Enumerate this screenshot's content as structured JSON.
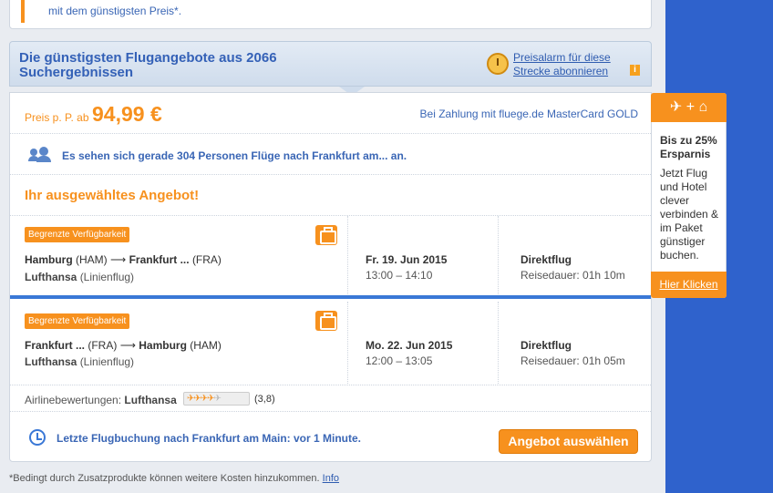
{
  "notice": {
    "text": "mit dem günstigsten Preis*."
  },
  "header": {
    "title": "Die günstigsten Flugangebote aus 2066 Suchergebnissen",
    "alarm_line1": "Preisalarm für diese",
    "alarm_line2": "Strecke abonnieren",
    "info_glyph": "i"
  },
  "price": {
    "label": "Preis p. P. ab",
    "value": "94,99 €",
    "payment_note": "Bei Zahlung mit fluege.de MasterCard GOLD"
  },
  "people": {
    "text": "Es sehen sich gerade 304 Personen Flüge nach Frankfurt am... an."
  },
  "selected": {
    "title": "Ihr ausgewähltes Angebot!"
  },
  "flights": [
    {
      "badge": "Begrenzte Verfügbarkeit",
      "from_city": "Hamburg",
      "from_code": "(HAM)",
      "arrow": "⟶",
      "to_city": "Frankfurt ...",
      "to_code": "(FRA)",
      "airline": "Lufthansa",
      "airline_type": "(Linienflug)",
      "date": "Fr. 19. Jun 2015",
      "time": "13:00 – 14:10",
      "direct": "Direktflug",
      "duration": "Reisedauer: 01h 10m"
    },
    {
      "badge": "Begrenzte Verfügbarkeit",
      "from_city": "Frankfurt ...",
      "from_code": "(FRA)",
      "arrow": "⟶",
      "to_city": "Hamburg",
      "to_code": "(HAM)",
      "airline": "Lufthansa",
      "airline_type": "(Linienflug)",
      "date": "Mo. 22. Jun 2015",
      "time": "12:00 – 13:05",
      "direct": "Direktflug",
      "duration": "Reisedauer: 01h 05m"
    }
  ],
  "rating": {
    "label": "Airlinebewertungen:",
    "airline": "Lufthansa",
    "value": "(3,8)",
    "stars": 3.8,
    "stars_max": 5
  },
  "last_booking": {
    "text": "Letzte Flugbuchung nach Frankfurt am Main: vor 1 Minute."
  },
  "select_button": "Angebot auswählen",
  "footnote": {
    "text": "*Bedingt durch Zusatzprodukte können weitere Kosten hinzukommen.",
    "link": "Info"
  },
  "promo": {
    "icons": "✈ + ⌂",
    "title": "Bis zu 25% Ersparnis",
    "body": "Jetzt Flug und Hotel clever verbinden & im Paket günstiger buchen.",
    "link": "Hier Klicken"
  },
  "colors": {
    "accent": "#f7911e",
    "link_blue": "#3a66b5",
    "side_blue": "#2f62cc"
  }
}
